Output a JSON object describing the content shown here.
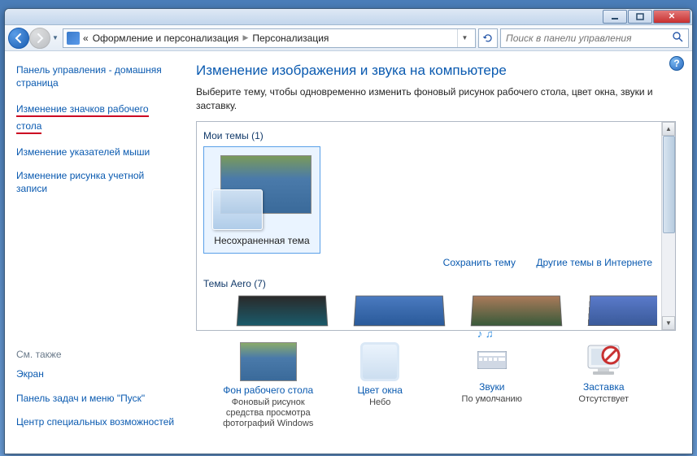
{
  "breadcrumb": {
    "chev": "«",
    "part1": "Оформление и персонализация",
    "part2": "Персонализация"
  },
  "search": {
    "placeholder": "Поиск в панели управления"
  },
  "sidebar": {
    "links": [
      "Панель управления - домашняя страница",
      "Изменение значков рабочего стола",
      "Изменение указателей мыши",
      "Изменение рисунка учетной записи"
    ],
    "see_also_title": "См. также",
    "see_also": [
      "Экран",
      "Панель задач и меню \"Пуск\"",
      "Центр специальных возможностей"
    ]
  },
  "main": {
    "title": "Изменение изображения и звука на компьютере",
    "subtitle": "Выберите тему, чтобы одновременно изменить фоновый рисунок рабочего стола, цвет окна, звуки и заставку.",
    "my_themes_label": "Мои темы (1)",
    "theme1_label": "Несохраненная тема",
    "save_theme": "Сохранить тему",
    "other_themes": "Другие темы в Интернете",
    "aero_label": "Темы Aero (7)"
  },
  "bottom": {
    "wallpaper_title": "Фон рабочего стола",
    "wallpaper_sub": "Фоновый рисунок средства просмотра фотографий Windows",
    "color_title": "Цвет окна",
    "color_sub": "Небо",
    "sounds_title": "Звуки",
    "sounds_sub": "По умолчанию",
    "saver_title": "Заставка",
    "saver_sub": "Отсутствует"
  }
}
